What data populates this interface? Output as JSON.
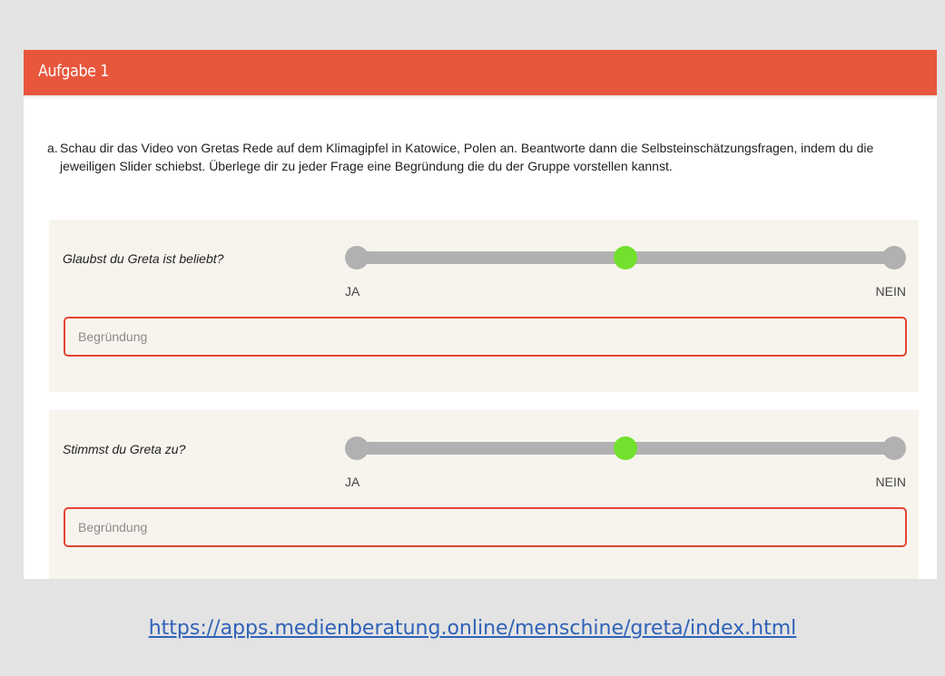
{
  "header": {
    "title": "Aufgabe 1"
  },
  "instruction": {
    "prefix": "a.",
    "text": "Schau dir das Video von Gretas Rede auf dem Klimagipfel in Katowice, Polen an. Beantworte dann die Selbsteinschätzungsfragen, indem du die jeweiligen Slider schiebst. Überlege dir zu jeder Frage eine Begründung die du der Gruppe vorstellen kannst."
  },
  "questions": [
    {
      "label": "Glaubst du Greta ist beliebt?",
      "slider_value": 0.5,
      "scale_min_label": "JA",
      "scale_max_label": "NEIN",
      "reason_placeholder": "Begründung",
      "reason_value": ""
    },
    {
      "label": "Stimmst du Greta zu?",
      "slider_value": 0.5,
      "scale_min_label": "JA",
      "scale_max_label": "NEIN",
      "reason_placeholder": "Begründung",
      "reason_value": ""
    }
  ],
  "footer": {
    "link_text": "https://apps.medienberatung.online/menschine/greta/index.html"
  },
  "colors": {
    "page_background": "#e3e3e3",
    "header_accent": "#e8563c",
    "question_background": "#f7f4ee",
    "slider_track": "#b1b1b1",
    "slider_thumb": "#73e02d",
    "input_border": "#e44432",
    "link": "#2f62b8"
  }
}
